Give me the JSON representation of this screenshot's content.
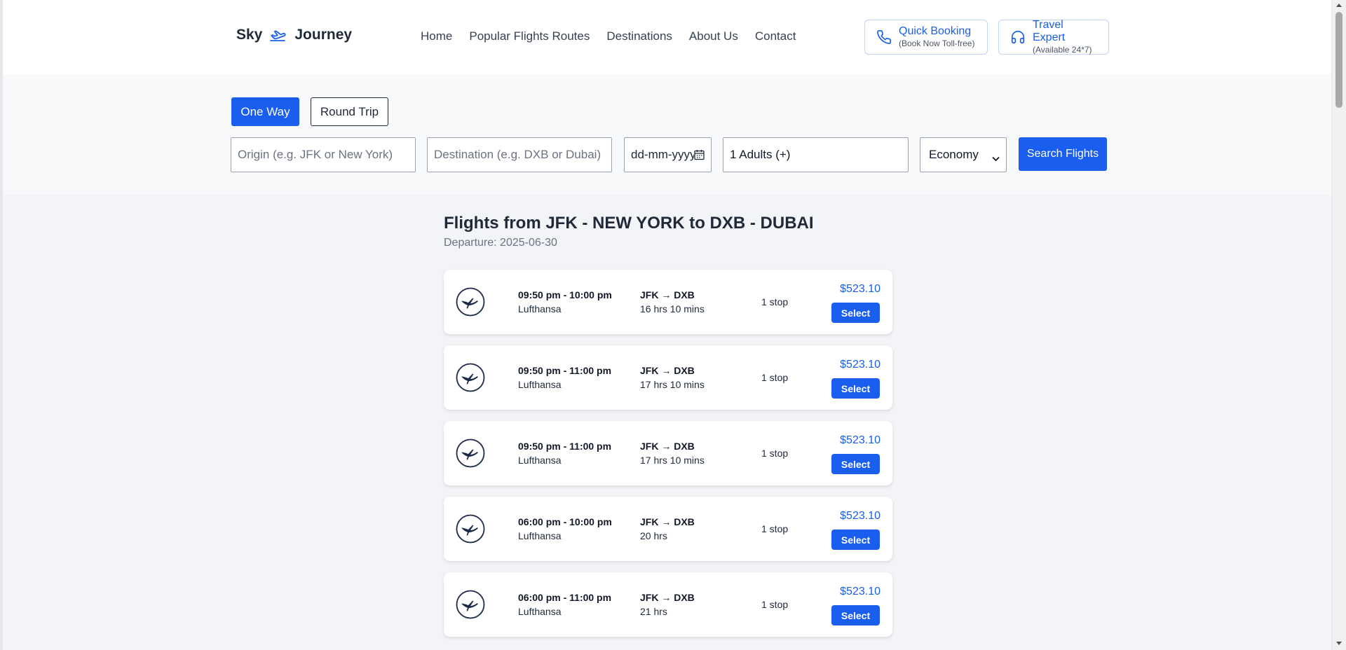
{
  "header": {
    "logo_left": "Sky",
    "logo_right": "Journey",
    "logo_icon": "plane-takeoff-icon",
    "nav": [
      "Home",
      "Popular Flights Routes",
      "Destinations",
      "About Us",
      "Contact"
    ],
    "quick_booking": {
      "title": "Quick Booking",
      "subtitle": "(Book Now Toll-free)",
      "icon": "phone-icon"
    },
    "travel_expert": {
      "title": "Travel Expert",
      "subtitle": "(Available 24*7)",
      "icon": "headset-icon"
    }
  },
  "search": {
    "trip_types": [
      "One Way",
      "Round Trip"
    ],
    "selected_trip_type": "One Way",
    "origin_placeholder": "Origin (e.g. JFK or New York)",
    "destination_placeholder": "Destination (e.g. DXB or Dubai)",
    "date_placeholder": "dd-mm-yyyy",
    "passengers": "1 Adults (+)",
    "cabin_class": "Economy",
    "search_button": "Search Flights"
  },
  "results": {
    "title": "Flights from JFK - NEW YORK to DXB - DUBAI",
    "subtitle": "Departure: 2025-06-30",
    "flights": [
      {
        "times": "09:50 pm - 10:00 pm",
        "airline": "Lufthansa",
        "route": "JFK → DXB",
        "duration": "16 hrs 10 mins",
        "stops": "1 stop",
        "price": "$523.10",
        "select": "Select"
      },
      {
        "times": "09:50 pm - 11:00 pm",
        "airline": "Lufthansa",
        "route": "JFK → DXB",
        "duration": "17 hrs 10 mins",
        "stops": "1 stop",
        "price": "$523.10",
        "select": "Select"
      },
      {
        "times": "09:50 pm - 11:00 pm",
        "airline": "Lufthansa",
        "route": "JFK → DXB",
        "duration": "17 hrs 10 mins",
        "stops": "1 stop",
        "price": "$523.10",
        "select": "Select"
      },
      {
        "times": "06:00 pm - 10:00 pm",
        "airline": "Lufthansa",
        "route": "JFK → DXB",
        "duration": "20 hrs",
        "stops": "1 stop",
        "price": "$523.10",
        "select": "Select"
      },
      {
        "times": "06:00 pm - 11:00 pm",
        "airline": "Lufthansa",
        "route": "JFK → DXB",
        "duration": "21 hrs",
        "stops": "1 stop",
        "price": "$523.10",
        "select": "Select"
      }
    ]
  },
  "colors": {
    "accent": "#1a5ef0",
    "price": "#1a5ee8",
    "background": "#f2f4f7",
    "airline_logo": "#1e2a4a"
  }
}
